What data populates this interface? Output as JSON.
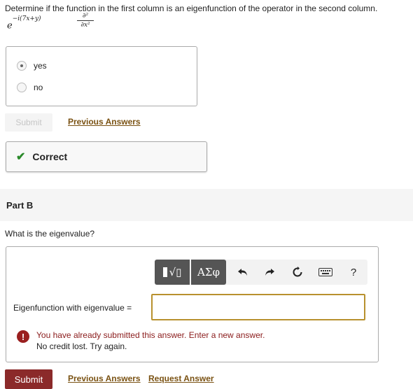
{
  "part_a": {
    "question": "Determine if the function in the first column is an eigenfunction of the operator in the second column.",
    "function_base": "e",
    "function_exponent": "−i(7x+y)",
    "operator_numerator": "∂²",
    "operator_denominator": "∂x²",
    "choices": [
      {
        "label": "yes",
        "selected": true
      },
      {
        "label": "no",
        "selected": false
      }
    ],
    "submit_label": "Submit",
    "previous_answers_label": "Previous Answers",
    "feedback_icon": "checkmark-icon",
    "feedback_text": "Correct",
    "feedback_color": "#2a8a2a"
  },
  "part_b": {
    "title": "Part B",
    "question": "What is the eigenvalue?",
    "toolbar": {
      "templates_icon": "templates-icon",
      "templates_glyph": "√▯",
      "symbols_label": "ΑΣφ",
      "undo_icon": "undo-icon",
      "redo_icon": "redo-icon",
      "reset_icon": "reset-icon",
      "keyboard_icon": "keyboard-icon",
      "help_label": "?"
    },
    "input_label": "Eigenfunction with eigenvalue =",
    "input_value": "",
    "warning_icon_glyph": "!",
    "warning_line1": "You have already submitted this answer. Enter a new answer.",
    "warning_line2": "No credit lost. Try again.",
    "submit_label": "Submit",
    "previous_answers_label": "Previous Answers",
    "request_answer_label": "Request Answer",
    "accent_color": "#8b2a2a",
    "link_color": "#7a5213"
  }
}
